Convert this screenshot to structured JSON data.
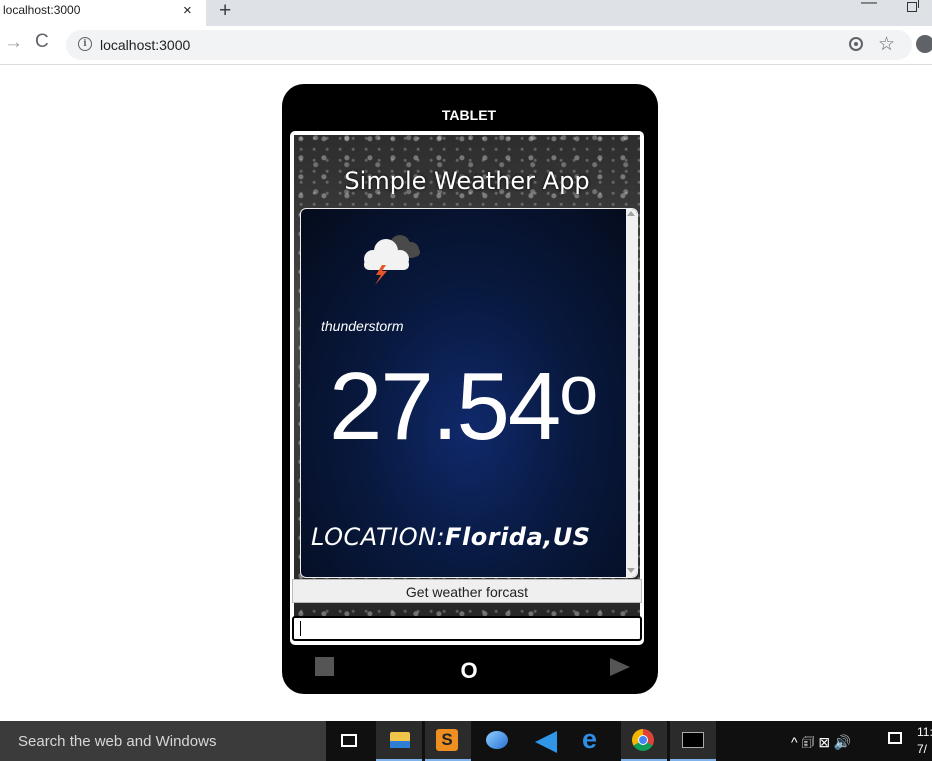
{
  "browser": {
    "tab_title": "localhost:3000",
    "tab_close": "×",
    "new_tab": "+",
    "minimize": "—",
    "address": "localhost:3000",
    "forward": "→",
    "reload": "C",
    "info": "i",
    "bookmark": "☆"
  },
  "tablet": {
    "label": "TABLET",
    "home_button": "O"
  },
  "app": {
    "title": "Simple Weather App",
    "weather_icon": "thunderstorm-cloud-icon",
    "description": "thunderstorm",
    "temperature": "27.54",
    "degree_symbol": "o",
    "location_label": "LOCATION:",
    "location_value": "Florida,US",
    "button_label": "Get weather forcast",
    "city_input_value": ""
  },
  "taskbar": {
    "search_placeholder": "Search the web and Windows",
    "clock_time": "11:",
    "clock_date": "7/",
    "tray_text": "^ 🗊 ⊠ 🔊"
  },
  "colors": {
    "tablet_frame": "#000000",
    "card_bg": "#0a1c4a",
    "taskbar": "#101010"
  }
}
